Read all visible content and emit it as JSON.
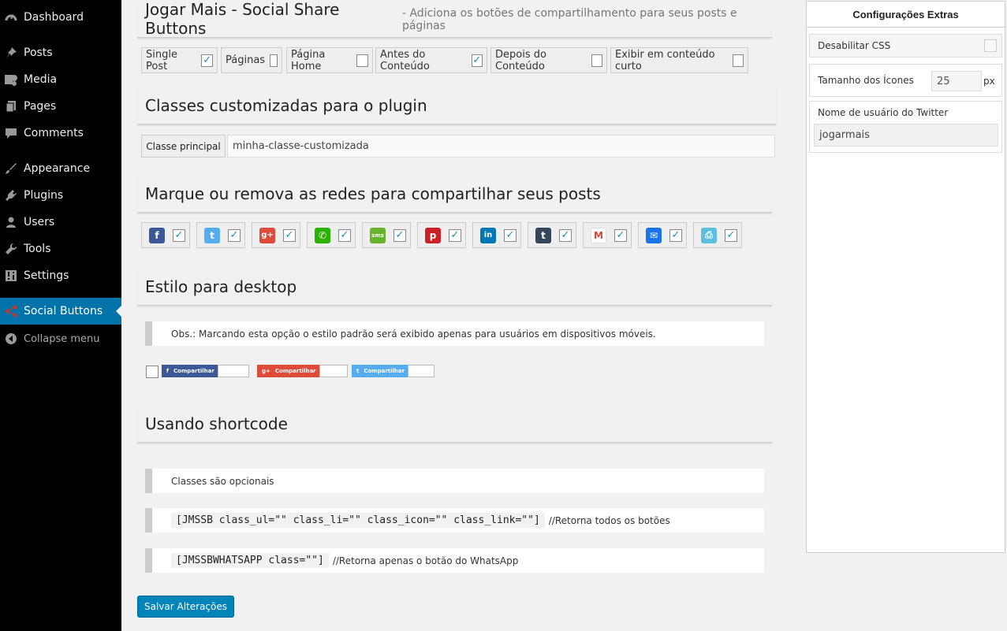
{
  "sidebar": {
    "items": [
      {
        "label": "Dashboard",
        "icon": "dashboard-icon"
      },
      {
        "label": "Posts",
        "icon": "pin-icon"
      },
      {
        "label": "Media",
        "icon": "media-icon"
      },
      {
        "label": "Pages",
        "icon": "pages-icon"
      },
      {
        "label": "Comments",
        "icon": "comment-icon"
      },
      {
        "label": "Appearance",
        "icon": "brush-icon"
      },
      {
        "label": "Plugins",
        "icon": "plugin-icon"
      },
      {
        "label": "Users",
        "icon": "user-icon"
      },
      {
        "label": "Tools",
        "icon": "wrench-icon"
      },
      {
        "label": "Settings",
        "icon": "settings-icon"
      },
      {
        "label": "Social Buttons",
        "icon": "share-icon"
      }
    ],
    "collapse_label": "Collapse menu"
  },
  "header": {
    "title": "Jogar Mais - Social Share Buttons",
    "subtitle": "- Adiciona os botões de compartilhamento para seus posts e páginas"
  },
  "options": [
    {
      "label": "Single Post",
      "checked": "✓"
    },
    {
      "label": "Páginas",
      "checked": ""
    },
    {
      "label": "Página Home",
      "checked": ""
    },
    {
      "label": "Antes do Conteúdo",
      "checked": "✓"
    },
    {
      "label": "Depois do Conteúdo",
      "checked": ""
    },
    {
      "label": "Exibir em conteúdo curto",
      "checked": ""
    }
  ],
  "custom_classes": {
    "title": "Classes customizadas para o plugin",
    "label": "Classe principal",
    "value": "minha-classe-customizada"
  },
  "networks": {
    "title": "Marque ou remova as redes para compartilhar seus posts",
    "items": [
      {
        "name": "facebook",
        "glyph": "f",
        "color": "#3b5998",
        "checked": "✓"
      },
      {
        "name": "twitter",
        "glyph": "t",
        "color": "#55acee",
        "checked": "✓"
      },
      {
        "name": "google-plus",
        "glyph": "g+",
        "color": "#dd4b39",
        "checked": "✓"
      },
      {
        "name": "whatsapp",
        "glyph": "✆",
        "color": "#2ab200",
        "checked": "✓"
      },
      {
        "name": "sms",
        "glyph": "sms",
        "color": "#66b32e",
        "checked": "✓"
      },
      {
        "name": "pinterest",
        "glyph": "p",
        "color": "#cb2027",
        "checked": "✓"
      },
      {
        "name": "linkedin",
        "glyph": "in",
        "color": "#0077b5",
        "checked": "✓"
      },
      {
        "name": "tumblr",
        "glyph": "t",
        "color": "#35465c",
        "checked": "✓"
      },
      {
        "name": "gmail",
        "glyph": "M",
        "color": "#d44638",
        "checked": "✓"
      },
      {
        "name": "email",
        "glyph": "✉",
        "color": "#1a73e8",
        "checked": "✓"
      },
      {
        "name": "print",
        "glyph": "⎙",
        "color": "#5bc0de",
        "checked": "✓"
      }
    ]
  },
  "desktop": {
    "title": "Estilo para desktop",
    "notice": "Obs.: Marcando esta opção o estilo padrão será exibido apenas para usuários em dispositivos móveis.",
    "preview_buttons": [
      {
        "network": "facebook",
        "glyph": "f",
        "label": "Compartilhar",
        "color": "#3b5998"
      },
      {
        "network": "google-plus",
        "glyph": "g+",
        "label": "Compartilhar",
        "color": "#dd4b39"
      },
      {
        "network": "twitter",
        "glyph": "t",
        "label": "Compartilhar",
        "color": "#55acee"
      }
    ]
  },
  "shortcode": {
    "title": "Usando shortcode",
    "note": "Classes são opcionais",
    "line1_code": "[JMSSB class_ul=\"\" class_li=\"\" class_icon=\"\" class_link=\"\"]",
    "line1_comment": "//Retorna todos os botões",
    "line2_code": "[JMSSBWHATSAPP class=\"\"]",
    "line2_comment": "//Retorna apenas o botão do WhatsApp"
  },
  "save_label": "Salvar Alterações",
  "extras": {
    "title": "Configurações Extras",
    "disable_css_label": "Desabilitar CSS",
    "icon_size_label": "Tamanho dos Ícones",
    "icon_size_value": "25",
    "icon_size_unit": "px",
    "twitter_label": "Nome de usuário do Twitter",
    "twitter_value": "jogarmais"
  }
}
